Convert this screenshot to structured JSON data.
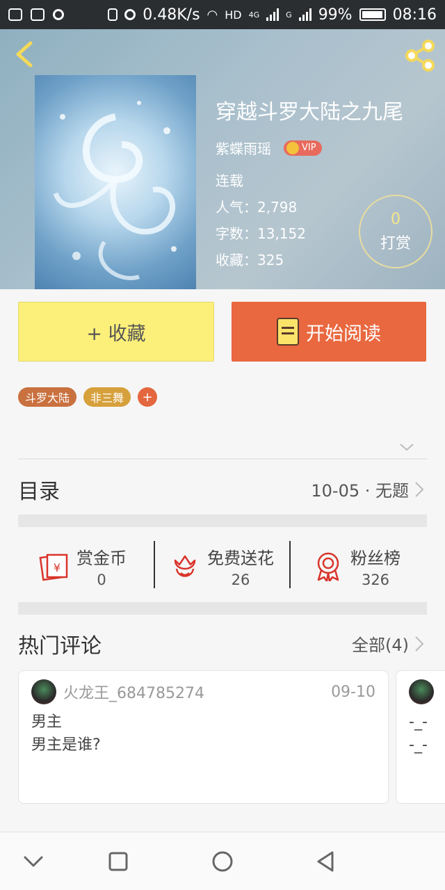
{
  "status_bar": {
    "speed": "0.48K/s",
    "network_hd": "HD",
    "network_4g": "4G",
    "network_g": "G",
    "battery": "99%",
    "time": "08:16"
  },
  "book": {
    "title": "穿越斗罗大陆之九尾",
    "author": "紫蝶雨瑶",
    "vip": "VIP",
    "status": "连载",
    "popularity": "人气：2,798",
    "word_count": "字数：13,152",
    "favorites": "收藏：325"
  },
  "reward": {
    "count": "0",
    "label": "打赏"
  },
  "buttons": {
    "favorite": "+ 收藏",
    "read": "开始阅读"
  },
  "tags": [
    "斗罗大陆",
    "非三舞",
    "+"
  ],
  "toc": {
    "title": "目录",
    "latest": "10-05 · 无题"
  },
  "stats": [
    {
      "label": "赏金币",
      "value": "0"
    },
    {
      "label": "免费送花",
      "value": "26"
    },
    {
      "label": "粉丝榜",
      "value": "326"
    }
  ],
  "comments_section": {
    "title": "热门评论",
    "all": "全部(4)"
  },
  "comments": [
    {
      "user": "火龙王_684785274",
      "date": "09-10",
      "line1": "男主",
      "line2": "男主是谁?"
    },
    {
      "user": "",
      "date": "",
      "line1": "-_-",
      "line2": "-_-"
    }
  ],
  "colors": {
    "favorite_button": "#fdf07a",
    "read_button": "#e9683f",
    "tag1": "#c9713f",
    "tag2": "#d6a03b",
    "accent_gold": "#f6e58b"
  }
}
